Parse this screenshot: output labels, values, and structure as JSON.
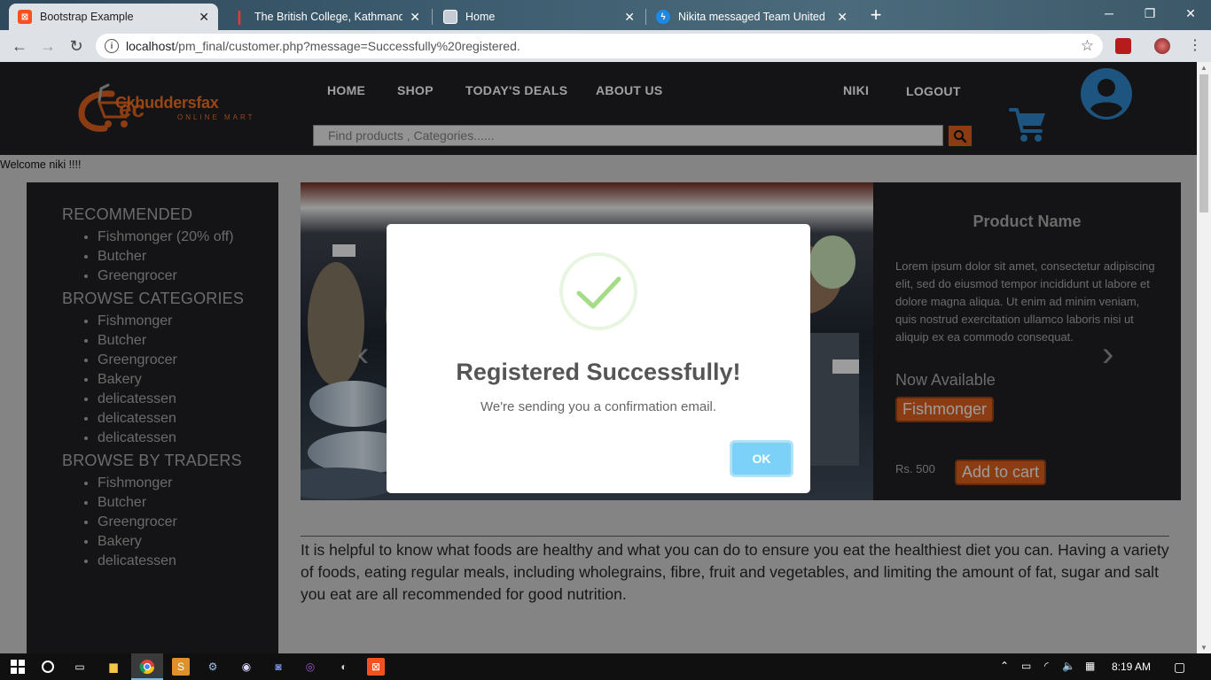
{
  "browser": {
    "tabs": [
      {
        "title": "Bootstrap Example",
        "active": true,
        "favicon_color": "#f4511e"
      },
      {
        "title": "The British College, Kathmandu :",
        "active": false,
        "favicon_color": "#b71c1c"
      },
      {
        "title": "Home",
        "active": false,
        "favicon_color": "#9aa6b5"
      },
      {
        "title": "Nikita messaged Team United",
        "active": false,
        "favicon_color": "#1e88e5"
      }
    ],
    "new_tab": "+",
    "url_host": "localhost",
    "url_path": "/pm_final/customer.php?message=Successfully%20registered."
  },
  "header": {
    "logo_text": "Ckhuddersfax",
    "logo_subtext": "ONLINE MART",
    "nav": [
      "HOME",
      "SHOP",
      "TODAY'S DEALS",
      "ABOUT US"
    ],
    "user_name": "NIKI",
    "logout": "LOGOUT",
    "search_placeholder": "Find products , Categories......",
    "accent_color": "#c8561a",
    "icon_color": "#2b7ab8"
  },
  "welcome": "Welcome niki !!!!",
  "sidebar": {
    "sections": [
      {
        "title": "RECOMMENDED",
        "items": [
          "Fishmonger (20% off)",
          "Butcher",
          "Greengrocer"
        ]
      },
      {
        "title": "BROWSE CATEGORIES",
        "items": [
          "Fishmonger",
          "Butcher",
          "Greengrocer",
          "Bakery",
          "delicatessen",
          "delicatessen",
          "delicatessen"
        ]
      },
      {
        "title": "BROWSE BY TRADERS",
        "items": [
          "Fishmonger",
          "Butcher",
          "Greengrocer",
          "Bakery",
          "delicatessen"
        ]
      }
    ]
  },
  "product": {
    "name": "Product Name",
    "description": "Lorem ipsum dolor sit amet, consectetur adipiscing elit, sed do eiusmod tempor incididunt ut labore et dolore magna aliqua. Ut enim ad minim veniam, quis nostrud exercitation ullamco laboris nisi ut aliquip ex ea commodo consequat.",
    "availability_label": "Now Available",
    "trader_button": "Fishmonger",
    "price": "Rs. 500",
    "add_to_cart": "Add to cart"
  },
  "article": "It is helpful to know what foods are healthy and what you can do to ensure you eat the healthiest diet you can. Having a variety of foods, eating regular meals, including wholegrains, fibre, fruit and vegetables, and limiting the amount of fat, sugar and salt you eat are all recommended for good nutrition.",
  "modal": {
    "title": "Registered Successfully!",
    "text": "We're sending you a confirmation email.",
    "ok": "OK",
    "check_color": "#a5dc86"
  },
  "taskbar": {
    "time": "8:19 AM"
  }
}
